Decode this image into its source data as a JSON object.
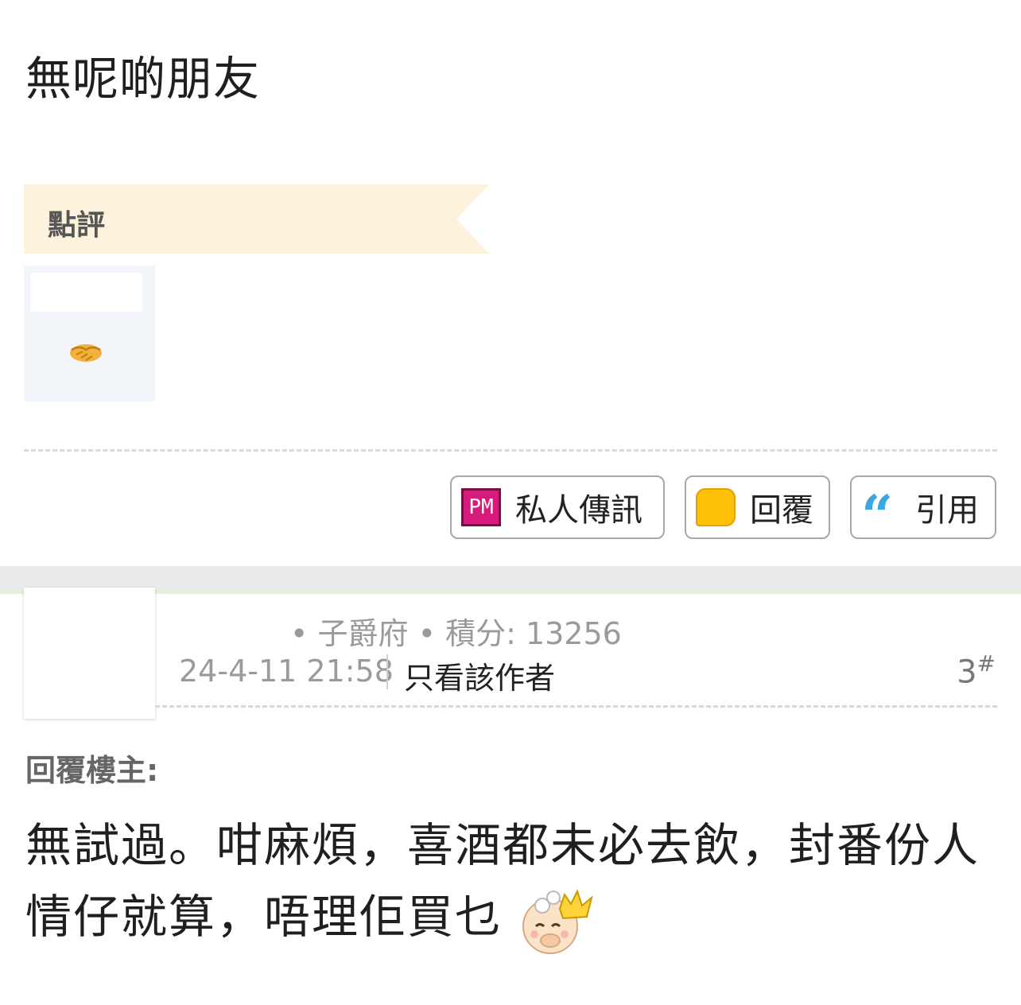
{
  "post": {
    "text": "無呢啲朋友"
  },
  "rating": {
    "header": "點評",
    "emoji_icon": "handshake-icon"
  },
  "actions": {
    "pm_label": "私人傳訊",
    "pm_icon_text": "PM",
    "reply_label": "回覆",
    "quote_label": "引用"
  },
  "reply_post": {
    "meta_line": "• 子爵府 • 積分: 13256",
    "timestamp": "24-4-11 21:58",
    "only_author": "只看該作者",
    "floor_number": "3",
    "floor_suffix": "#",
    "reply_label": "回覆樓主:",
    "body": "無試過。咁麻煩，喜酒都未必去飲，封番份人情仔就算，唔理佢買乜",
    "emoji_icon": "baby-king-emoji-icon"
  },
  "colors": {
    "banner_bg": "#fdf3dc",
    "pm_pink": "#d81b7a",
    "bubble_yellow": "#ffc107",
    "quote_blue": "#3aa7e0"
  }
}
